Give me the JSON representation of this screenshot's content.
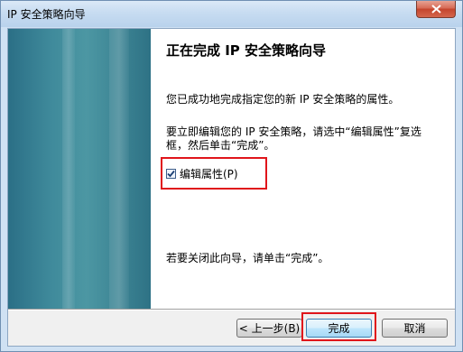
{
  "window": {
    "title": "IP 安全策略向导"
  },
  "content": {
    "heading": "正在完成 IP 安全策略向导",
    "paragraph1": "您已成功地完成指定您的新 IP 安全策略的属性。",
    "paragraph2": "要立即编辑您的 IP 安全策略，请选中“编辑属性”复选框，然后单击“完成”。",
    "checkbox_label": "编辑属性(P)",
    "checkbox_checked": true,
    "paragraph3": "若要关闭此向导，请单击“完成”。"
  },
  "buttons": {
    "back": "< 上一步(B)",
    "finish": "完成",
    "cancel": "取消"
  }
}
